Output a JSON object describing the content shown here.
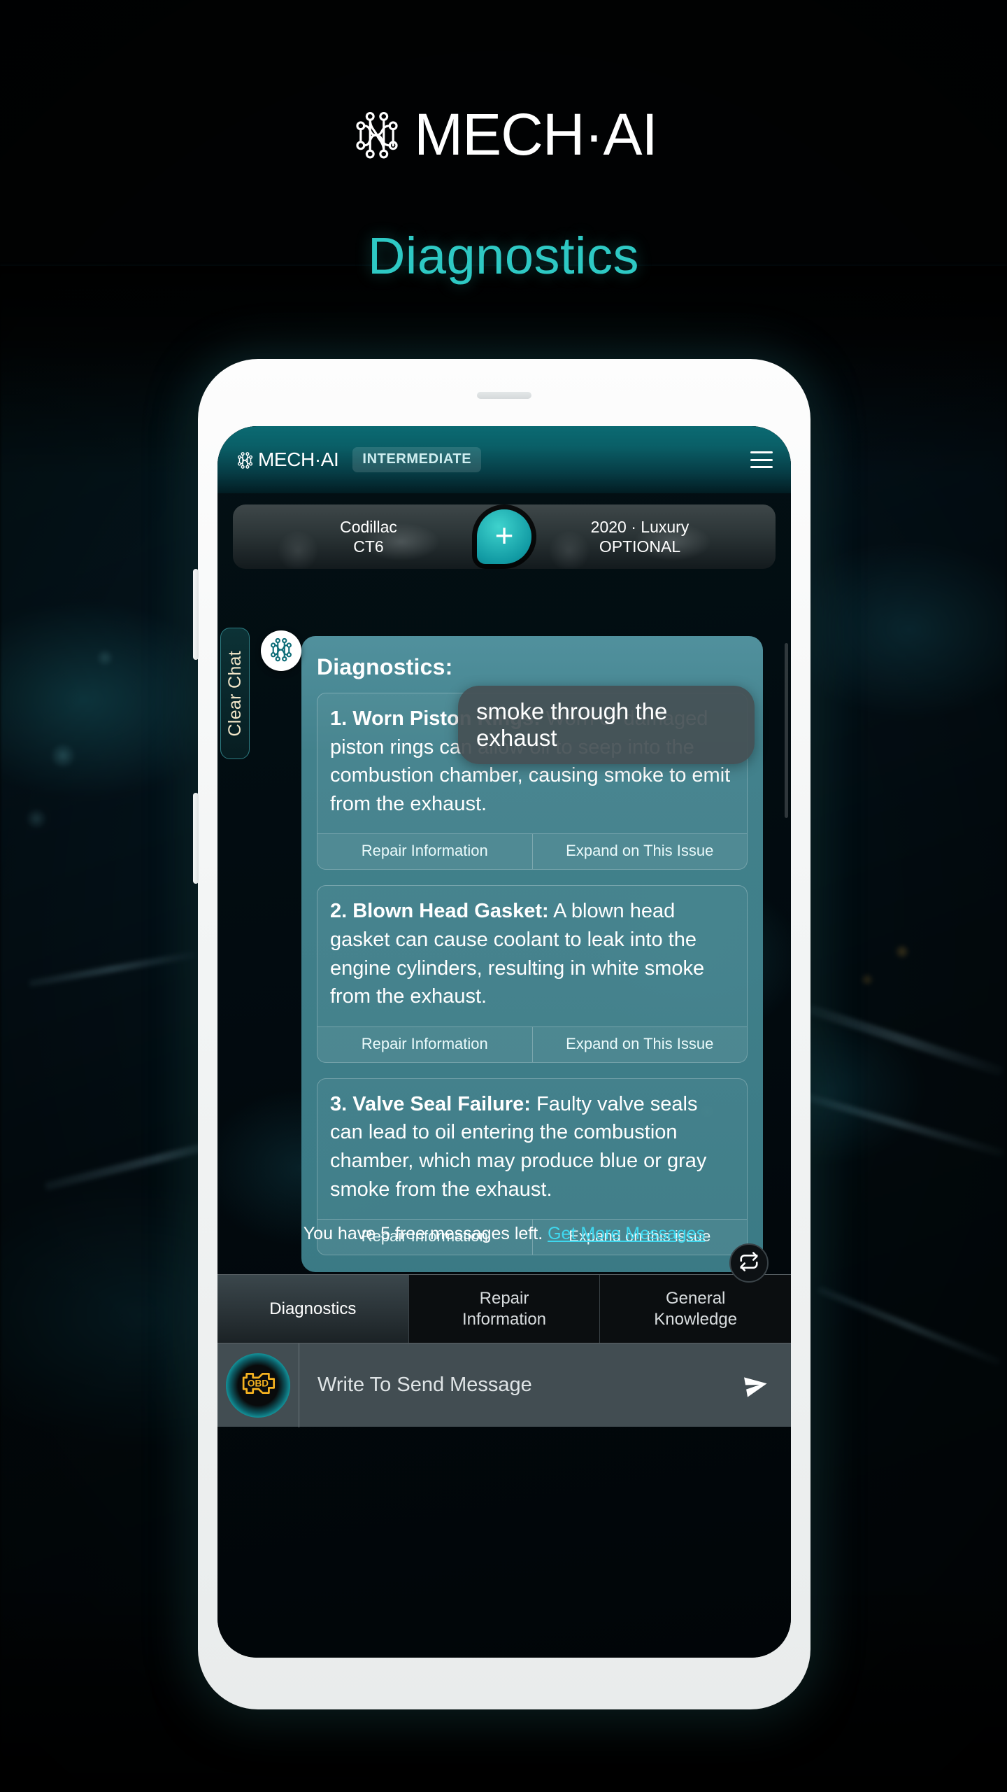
{
  "brand": {
    "name": "MECH·AI",
    "mark_icon": "circuit-neural-logo-icon"
  },
  "page_title": "Diagnostics",
  "app": {
    "header": {
      "logo_name": "MECH·AI",
      "logo_icon": "circuit-neural-logo-icon",
      "level_badge": "INTERMEDIATE",
      "menu_icon": "hamburger-menu-icon"
    },
    "vehicle": {
      "left_line1": "Codillac",
      "left_line2": "CT6",
      "right_line1": "2020 · Luxury",
      "right_line2": "OPTIONAL",
      "add_icon": "plus-icon"
    },
    "clear_chat_label": "Clear Chat",
    "assistant_avatar_icon": "circuit-neural-avatar-icon",
    "chat": {
      "title": "Diagnostics:",
      "user_message": "smoke through the exhaust",
      "issues": [
        {
          "heading": "1. Worn Piston Rings:",
          "text": " Worn or damaged piston rings can allow oil to seep into the combustion chamber, causing smoke to emit from the exhaust.",
          "action_repair": "Repair Information",
          "action_expand": "Expand on This Issue"
        },
        {
          "heading": "2. Blown Head Gasket:",
          "text": " A blown head gasket can cause coolant to leak into the engine cylinders, resulting in white smoke from the exhaust.",
          "action_repair": "Repair Information",
          "action_expand": "Expand on This Issue"
        },
        {
          "heading": "3. Valve Seal Failure:",
          "text": " Faulty valve seals can lead to oil entering the combustion chamber, which may produce blue or gray smoke from the exhaust.",
          "action_repair": "Repair Information",
          "action_expand": "Expand on this issue"
        }
      ]
    },
    "free_messages": {
      "text": "You have 5 free messages left.",
      "link": "Get More Messages",
      "count": 5
    },
    "refresh_icon": "refresh-repeat-icon",
    "tabs": [
      {
        "label": "Diagnostics",
        "active": true
      },
      {
        "label": "Repair\nInformation",
        "active": false
      },
      {
        "label": "General\nKnowledge",
        "active": false
      }
    ],
    "composer": {
      "obd_icon": "obd-check-engine-icon",
      "obd_label": "OBD",
      "placeholder": "Write To Send Message",
      "value": "",
      "send_icon": "send-paper-plane-icon"
    }
  },
  "colors": {
    "accent_teal": "#2ec9c4",
    "link_cyan": "#3fd8ef",
    "header_teal": "#0b6a72",
    "chat_panel": "#4a8d9a",
    "clear_chat_text": "#f3e7c9",
    "obd_amber": "#f5b220"
  }
}
